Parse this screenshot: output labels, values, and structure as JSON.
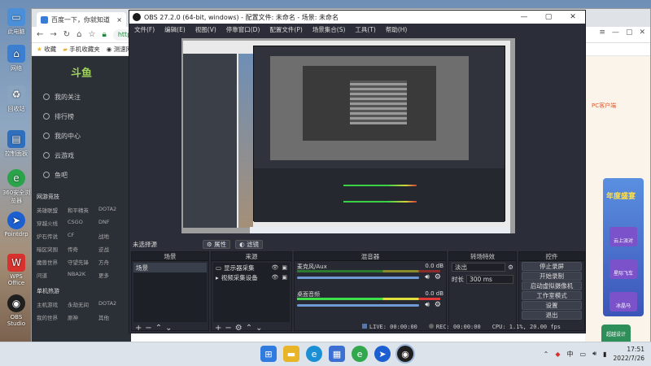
{
  "desktop": {
    "icons": [
      {
        "label": "此电脑",
        "icon": "computer-icon",
        "color": "#4a8fd8"
      },
      {
        "label": "网络",
        "icon": "network-icon",
        "color": "#3c7fd0"
      },
      {
        "label": "回收站",
        "icon": "recycle-bin-icon",
        "color": "#8aa4c0"
      },
      {
        "label": "控制面板",
        "icon": "control-panel-icon",
        "color": "#2f6fbd"
      },
      {
        "label": "360安全浏览器",
        "icon": "browser-icon",
        "color": "#2aa34a"
      },
      {
        "label": "Pointdrp",
        "icon": "pointdrp-icon",
        "color": "#1c5fd1"
      },
      {
        "label": "WPS Office",
        "icon": "wps-icon",
        "color": "#d8322f"
      },
      {
        "label": "OBS Studio",
        "icon": "obs-icon",
        "color": "#1f1f1f"
      }
    ]
  },
  "browser": {
    "tab_title": "百度一下，你就知道",
    "url": "https",
    "bookmarks": [
      "收藏",
      "手机收藏夹",
      "测速网"
    ],
    "side_logo": "斗鱼",
    "side_nav": [
      "我的关注",
      "排行榜",
      "我的中心",
      "云游戏",
      "鱼吧"
    ],
    "side_section1": "网游竞技",
    "side_grid1": [
      "英雄联盟",
      "和平精英",
      "DOTA2",
      "穿越火线",
      "CSGO",
      "DNF",
      "炉石传说",
      "CF",
      "战地",
      "暗区突围",
      "传奇",
      "逆战",
      "魔兽世界",
      "守望先锋",
      "方舟",
      "问道",
      "NBA2K",
      "更多"
    ],
    "side_section2": "单机热游",
    "side_grid2": [
      "主机游戏",
      "永劫无间",
      "DOTA2",
      "我的世界",
      "原神",
      "其他"
    ],
    "right_badge": "PC客户端",
    "right_ad_title": "年度盛宴",
    "right_ad_items": [
      "云上派对",
      "星际飞车",
      "冰晶马",
      "超越设计"
    ]
  },
  "obs": {
    "title": "OBS 27.2.0 (64-bit, windows) - 配置文件: 未命名 - 场景: 未命名",
    "menu": [
      "文件(F)",
      "编辑(E)",
      "视图(V)",
      "停靠窗口(D)",
      "配置文件(P)",
      "场景集合(S)",
      "工具(T)",
      "帮助(H)"
    ],
    "no_source": "未选择源",
    "props_button": "属性",
    "filters_button": "滤镜",
    "docks": {
      "scenes": {
        "title": "场景",
        "items": [
          "场景"
        ]
      },
      "sources": {
        "title": "来源",
        "items": [
          "显示器采集",
          "视频采集设备"
        ]
      },
      "mixer": {
        "title": "混音器",
        "channels": [
          {
            "name": "麦克风/Aux",
            "db": "0.0 dB"
          },
          {
            "name": "桌面音频",
            "db": "0.0 dB"
          }
        ]
      },
      "transitions": {
        "title": "转场特效",
        "type": "淡出",
        "duration_label": "时长",
        "duration": "300 ms"
      },
      "controls": {
        "title": "控件",
        "buttons": [
          "停止录屏",
          "开始录制",
          "启动虚拟摄像机",
          "工作室模式",
          "设置",
          "退出"
        ]
      }
    },
    "status": {
      "live": "LIVE: 00:00:00",
      "rec": "REC: 00:00:00",
      "cpu": "CPU: 1.1%, 20.00 fps"
    }
  },
  "taskbar": {
    "apps": [
      {
        "icon": "windows-start-icon",
        "color": "#2f7be0"
      },
      {
        "icon": "file-explorer-icon",
        "color": "#e8b428"
      },
      {
        "icon": "edge-icon",
        "color": "#1b8fd6"
      },
      {
        "icon": "store-icon",
        "color": "#3b6fd1"
      },
      {
        "icon": "360-browser-icon",
        "color": "#32a84e"
      },
      {
        "icon": "pointdrp-icon",
        "color": "#1c5fd1"
      },
      {
        "icon": "obs-icon",
        "color": "#1f1f1f"
      }
    ],
    "ime": "中",
    "time": "17:51",
    "date": "2022/7/26"
  }
}
